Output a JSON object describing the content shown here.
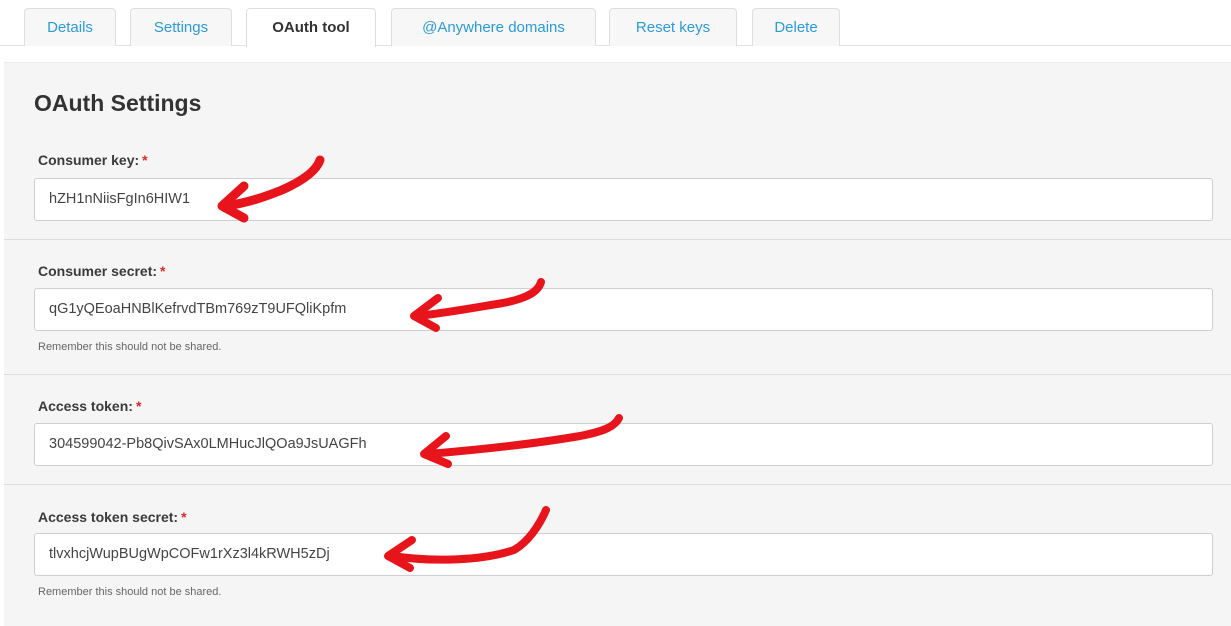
{
  "tabs": [
    {
      "label": "Details",
      "active": false
    },
    {
      "label": "Settings",
      "active": false
    },
    {
      "label": "OAuth tool",
      "active": true
    },
    {
      "label": "@Anywhere domains",
      "active": false
    },
    {
      "label": "Reset keys",
      "active": false
    },
    {
      "label": "Delete",
      "active": false
    }
  ],
  "page": {
    "title": "OAuth Settings"
  },
  "fields": {
    "required_marker": "*",
    "consumer_key": {
      "label": "Consumer key:",
      "value": "hZH1nNiisFgIn6HIW1"
    },
    "consumer_secret": {
      "label": "Consumer secret:",
      "value": "qG1yQEoaHNBlKefrvdTBm769zT9UFQliKpfm",
      "hint": "Remember this should not be shared."
    },
    "access_token": {
      "label": "Access token:",
      "value": "304599042-Pb8QivSAx0LMHucJlQOa9JsUAGFh"
    },
    "access_token_secret": {
      "label": "Access token secret:",
      "value": "tlvxhcjWupBUgWpCOFw1rXz3l4kRWH5zDj",
      "hint": "Remember this should not be shared."
    }
  },
  "colors": {
    "tab_link": "#2b9bd8",
    "required": "#d32b2b",
    "annotation_arrow": "#e8141b",
    "panel_bg": "#f5f5f5"
  },
  "icons": {
    "annotation": "red-arrow-icon"
  }
}
